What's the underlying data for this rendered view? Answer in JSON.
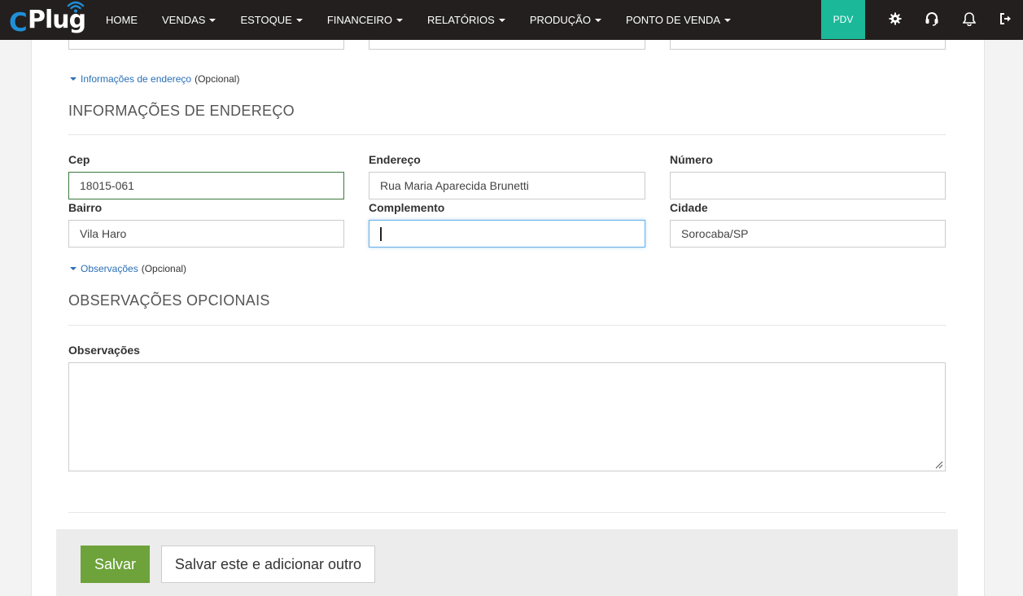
{
  "brand": {
    "logo_c": "C",
    "logo_text": "Plug"
  },
  "nav": {
    "items": [
      {
        "label": "HOME",
        "dropdown": false
      },
      {
        "label": "VENDAS",
        "dropdown": true
      },
      {
        "label": "ESTOQUE",
        "dropdown": true
      },
      {
        "label": "FINANCEIRO",
        "dropdown": true
      },
      {
        "label": "RELATÓRIOS",
        "dropdown": true
      },
      {
        "label": "PRODUÇÃO",
        "dropdown": true
      },
      {
        "label": "PONTO DE VENDA",
        "dropdown": true
      }
    ],
    "pdv_label": "PDV",
    "icons": [
      "gear-icon",
      "headset-icon",
      "bell-icon",
      "logout-icon"
    ]
  },
  "address_toggle": {
    "link": "Informações de endereço",
    "suffix": "(Opcional)"
  },
  "address_section": {
    "title": "INFORMAÇÕES DE ENDEREÇO",
    "fields": {
      "cep": {
        "label": "Cep",
        "value": "18015-061"
      },
      "endereco": {
        "label": "Endereço",
        "value": "Rua Maria Aparecida Brunetti"
      },
      "numero": {
        "label": "Número",
        "value": ""
      },
      "bairro": {
        "label": "Bairro",
        "value": "Vila Haro"
      },
      "complemento": {
        "label": "Complemento",
        "value": ""
      },
      "cidade": {
        "label": "Cidade",
        "value": "Sorocaba/SP"
      }
    }
  },
  "notes_toggle": {
    "link": "Observações",
    "suffix": "(Opcional)"
  },
  "notes_section": {
    "title": "OBSERVAÇÕES OPCIONAIS",
    "label": "Observações",
    "value": ""
  },
  "actions": {
    "save": "Salvar",
    "save_and_add": "Salvar este e adicionar outro"
  },
  "colors": {
    "navbar_bg": "#231f1e",
    "pdv_bg": "#1bb99a",
    "save_button": "#6da33a",
    "link": "#2a6fb5",
    "logo_blue": "#1f8fd8"
  }
}
